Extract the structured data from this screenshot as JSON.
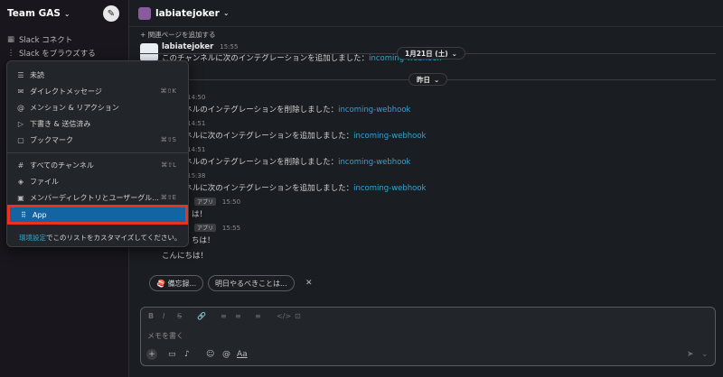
{
  "sidebar": {
    "workspace_name": "Team GAS",
    "items": [
      {
        "label": "Slack コネクト",
        "icon": "connect-icon"
      },
      {
        "label": "Slack をブラウズする",
        "icon": "more-icon"
      }
    ]
  },
  "channel": {
    "name": "labiatejoker",
    "bookmark_label": "関連ページを追加する"
  },
  "date_pills": {
    "first": "1月21日 (土)",
    "second": "昨日"
  },
  "messages": [
    {
      "user": "labiatejoker",
      "time": "15:55",
      "text": "このチャンネルに次のインテグレーションを追加しました：",
      "link": "incoming-webhook"
    },
    {
      "user": "oker",
      "time": "14:50",
      "text": "チャンネルのインテグレーションを削除しました：",
      "link": "incoming-webhook"
    },
    {
      "user": "oker",
      "time": "14:51",
      "text": "チャンネルに次のインテグレーションを追加しました：",
      "link": "incoming-webhook"
    },
    {
      "user": "oker",
      "time": "14:51",
      "text": "チャンネルのインテグレーションを削除しました：",
      "link": "incoming-webhook"
    },
    {
      "user": "oker",
      "time": "15:38",
      "text": "チャンネルに次のインテグレーションを追加しました：",
      "link": "incoming-webhook"
    },
    {
      "app_tag": "アプリ",
      "time": "15:50",
      "text": "は！"
    },
    {
      "app_tag": "アプリ",
      "time": "15:55",
      "text": "ちは！"
    },
    {
      "text": "こんにちは！"
    }
  ],
  "chips": {
    "first": "🍣 備忘録...",
    "second": "明日やるべきことは..."
  },
  "composer": {
    "placeholder": "メモを書く",
    "format_icons": [
      "B",
      "I",
      "S",
      "🔗",
      "≡",
      "≡",
      "≡",
      "</>",
      "⊡"
    ],
    "aa_label": "Aa"
  },
  "menu": {
    "items": [
      {
        "label": "未読",
        "icon": "unread-icon",
        "shortcut": ""
      },
      {
        "label": "ダイレクトメッセージ",
        "icon": "dm-icon",
        "shortcut": "⌘⇧K"
      },
      {
        "label": "メンション & リアクション",
        "icon": "mention-icon",
        "shortcut": ""
      },
      {
        "label": "下書き & 送信済み",
        "icon": "send-icon",
        "shortcut": ""
      },
      {
        "label": "ブックマーク",
        "icon": "bookmark-icon",
        "shortcut": "⌘⇧S"
      },
      {
        "label": "すべてのチャンネル",
        "icon": "channel-icon",
        "shortcut": "⌘⇧L"
      },
      {
        "label": "ファイル",
        "icon": "files-icon",
        "shortcut": ""
      },
      {
        "label": "メンバーディレクトリとユーザーグル...",
        "icon": "members-icon",
        "shortcut": "⌘⇧E"
      },
      {
        "label": "App",
        "icon": "apps-icon",
        "shortcut": ""
      }
    ],
    "footer_link": "環境設定",
    "footer_text": "でこのリストをカスタマイズしてください。"
  },
  "colors": {
    "accent": "#1264a3",
    "link": "#36a2d4",
    "highlight_border": "#e8341c"
  }
}
